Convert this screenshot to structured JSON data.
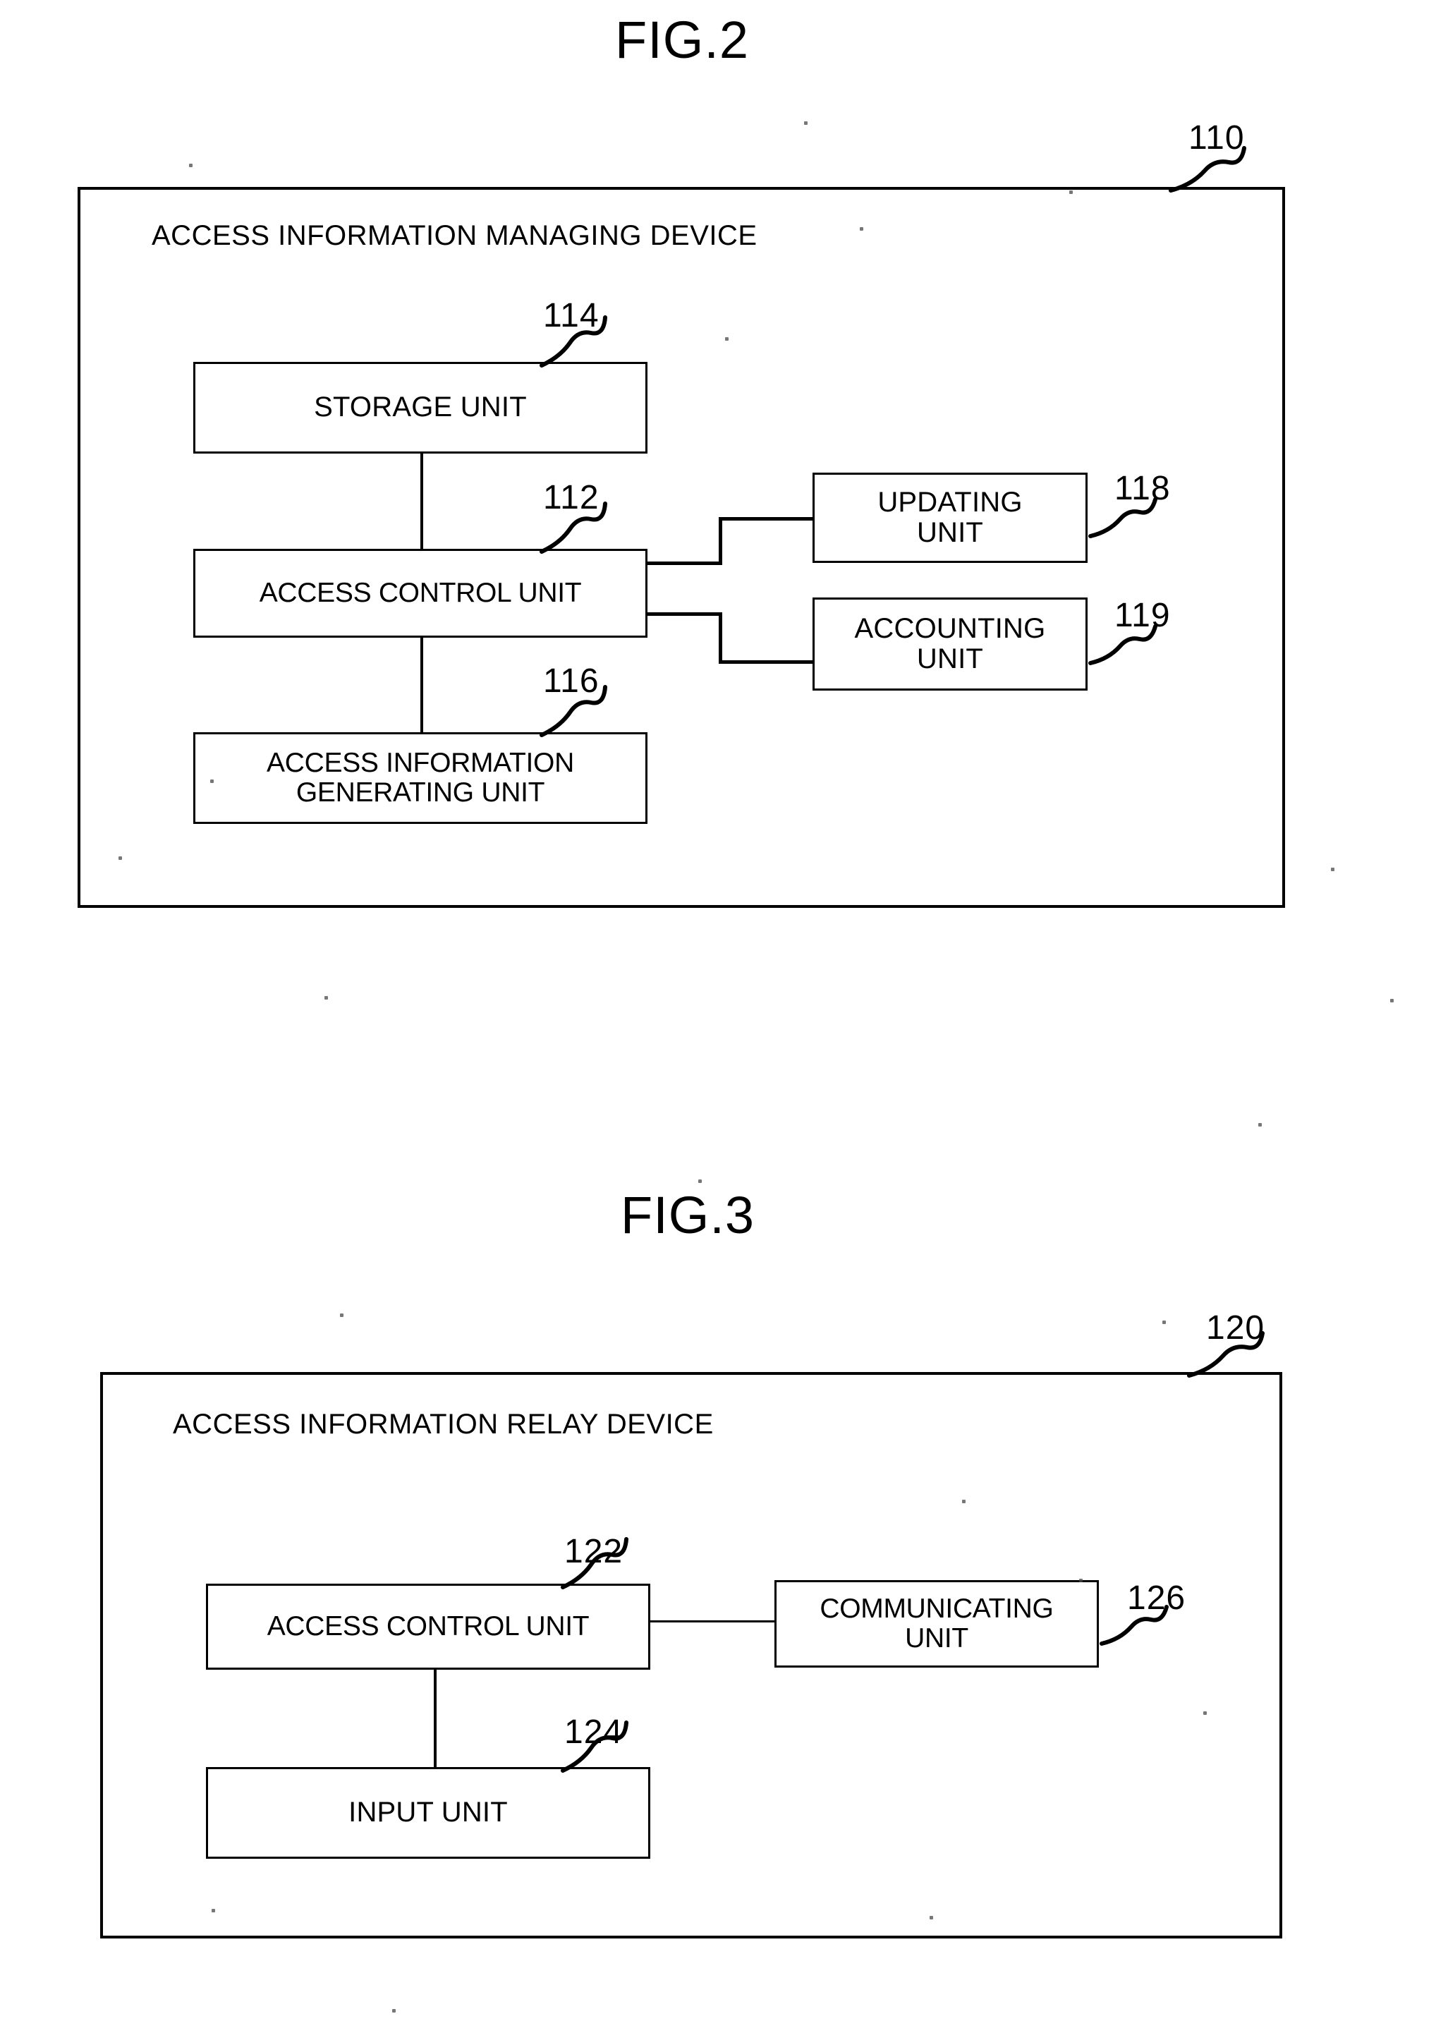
{
  "document": {
    "kind": "patent-drawing-sheet",
    "background_color": "#ffffff",
    "ink_color": "#000000"
  },
  "figures": [
    {
      "id": "fig2",
      "title": "FIG.2",
      "device_reference": "110",
      "device_heading": "ACCESS INFORMATION MANAGING DEVICE",
      "blocks": [
        {
          "id": "storage-unit",
          "label": "STORAGE UNIT",
          "reference": "114"
        },
        {
          "id": "access-control-unit",
          "label": "ACCESS CONTROL UNIT",
          "reference": "112"
        },
        {
          "id": "access-info-gen-unit",
          "label": "ACCESS INFORMATION\nGENERATING UNIT",
          "reference": "116"
        },
        {
          "id": "updating-unit",
          "label": "UPDATING\nUNIT",
          "reference": "118"
        },
        {
          "id": "accounting-unit",
          "label": "ACCOUNTING\nUNIT",
          "reference": "119"
        }
      ],
      "connections": [
        {
          "from": "storage-unit",
          "to": "access-control-unit",
          "style": "vertical"
        },
        {
          "from": "access-control-unit",
          "to": "access-info-gen-unit",
          "style": "vertical"
        },
        {
          "from": "access-control-unit",
          "to": "updating-unit",
          "style": "stepped-up"
        },
        {
          "from": "access-control-unit",
          "to": "accounting-unit",
          "style": "stepped-down"
        }
      ]
    },
    {
      "id": "fig3",
      "title": "FIG.3",
      "device_reference": "120",
      "device_heading": "ACCESS INFORMATION RELAY DEVICE",
      "blocks": [
        {
          "id": "access-control-unit-relay",
          "label": "ACCESS CONTROL UNIT",
          "reference": "122"
        },
        {
          "id": "input-unit",
          "label": "INPUT UNIT",
          "reference": "124"
        },
        {
          "id": "communicating-unit",
          "label": "COMMUNICATING\nUNIT",
          "reference": "126"
        }
      ],
      "connections": [
        {
          "from": "access-control-unit-relay",
          "to": "communicating-unit",
          "style": "horizontal"
        },
        {
          "from": "access-control-unit-relay",
          "to": "input-unit",
          "style": "vertical"
        }
      ]
    }
  ]
}
